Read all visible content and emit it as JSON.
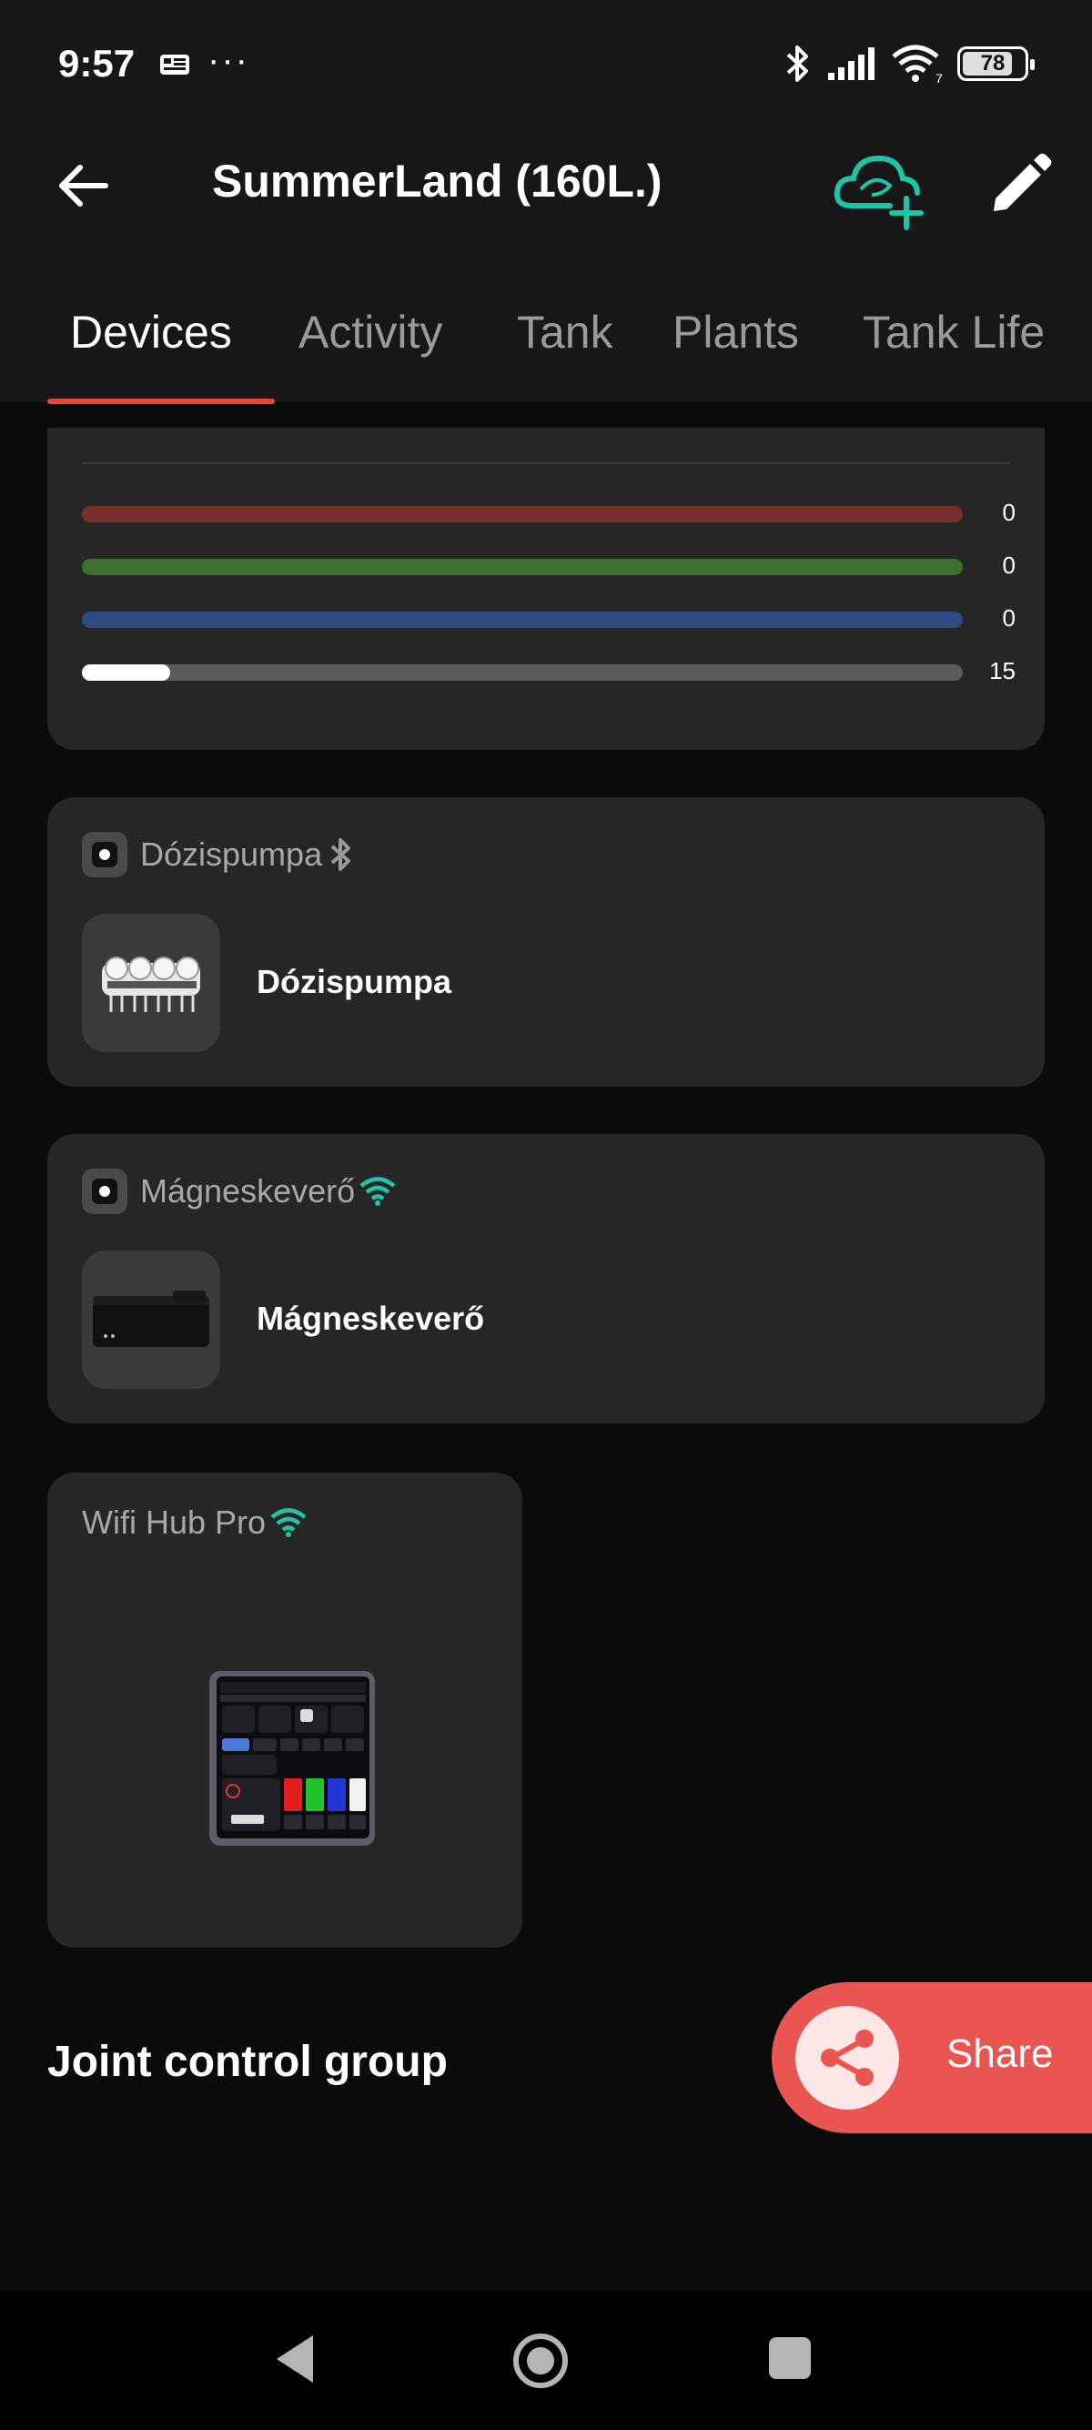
{
  "status_bar": {
    "time": "9:57",
    "more_dots": "···",
    "battery": "78",
    "icons": [
      "notification-icon",
      "bluetooth-icon",
      "signal-icon",
      "wifi-icon",
      "battery-icon"
    ]
  },
  "app_bar": {
    "title": "SummerLand (160L.)",
    "icons": [
      "back-arrow-icon",
      "cloud-add-icon",
      "edit-pencil-icon"
    ]
  },
  "tabs": [
    {
      "label": "Devices",
      "active": true
    },
    {
      "label": "Activity",
      "active": false
    },
    {
      "label": "Tank",
      "active": false
    },
    {
      "label": "Plants",
      "active": false
    },
    {
      "label": "Tank Life",
      "active": false
    }
  ],
  "light_channels": [
    {
      "color": "#7a2f2b",
      "value": "0",
      "level": 0
    },
    {
      "color": "#3f6f2d",
      "value": "0",
      "level": 0
    },
    {
      "color": "#2d4a82",
      "value": "0",
      "level": 0
    },
    {
      "color": "#5a5a5a",
      "value": "15",
      "level": 0.1
    }
  ],
  "devices": [
    {
      "header": "Dózispumpa",
      "name": "Dózispumpa",
      "connection_icon": "bluetooth-icon"
    },
    {
      "header": "Mágneskeverő",
      "name": "Mágneskeverő",
      "connection_icon": "wifi-icon"
    }
  ],
  "hub": {
    "name": "Wifi Hub Pro",
    "connection_icon": "wifi-icon"
  },
  "section": {
    "title": "Joint control group"
  },
  "share": {
    "label": "Share"
  },
  "colors": {
    "accent": "#e5473f",
    "wifi": "#1fc3a6",
    "card": "#262626",
    "share": "#ea5451"
  }
}
